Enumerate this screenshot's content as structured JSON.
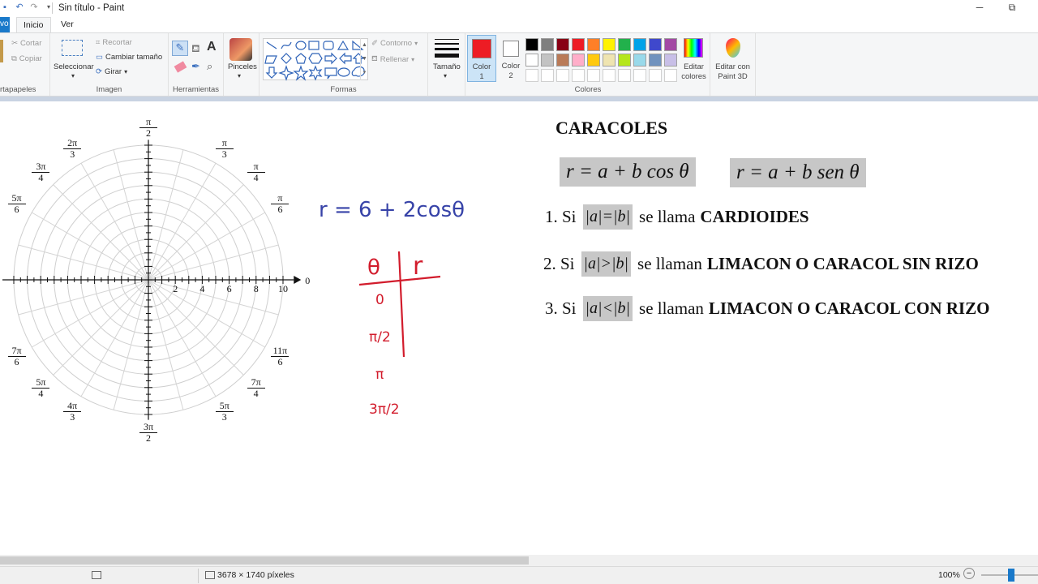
{
  "window": {
    "title": "Sin título - Paint",
    "minimize": "─",
    "restore": "⧉"
  },
  "tabs": {
    "file": "vo",
    "home": "Inicio",
    "view": "Ver"
  },
  "ribbon": {
    "clipboard": {
      "cut": "Cortar",
      "copy": "Copiar",
      "label": "rtapapeles"
    },
    "image": {
      "select": "Seleccionar",
      "crop": "Recortar",
      "resize": "Cambiar tamaño",
      "rotate": "Girar",
      "label": "Imagen"
    },
    "tools": {
      "label": "Herramientas",
      "text_glyph": "A"
    },
    "brushes": {
      "label": "Pinceles"
    },
    "shapes": {
      "outline": "Contorno",
      "fill": "Rellenar",
      "label": "Formas"
    },
    "size": {
      "label": "Tamaño"
    },
    "color1": {
      "label1": "Color",
      "label2": "1",
      "value": "#ed1c24"
    },
    "color2": {
      "label1": "Color",
      "label2": "2",
      "value": "#ffffff"
    },
    "colors": {
      "label": "Colores",
      "row1": [
        "#000000",
        "#7f7f7f",
        "#880015",
        "#ed1c24",
        "#ff7f27",
        "#fff200",
        "#22b14c",
        "#00a2e8",
        "#3f48cc",
        "#a349a4"
      ],
      "row2": [
        "#ffffff",
        "#c3c3c3",
        "#b97a57",
        "#ffaec9",
        "#ffc90e",
        "#efe4b0",
        "#b5e61d",
        "#99d9ea",
        "#7092be",
        "#c8bfe7"
      ]
    },
    "edit_colors": {
      "line1": "Editar",
      "line2": "colores"
    },
    "paint3d": {
      "line1": "Editar con",
      "line2": "Paint 3D"
    }
  },
  "canvas": {
    "heading": "CARACOLES",
    "formula_cos": "r = a + b cos θ",
    "formula_sen": "r = a + b sen θ",
    "items": [
      {
        "num": "1.",
        "si": "Si",
        "cond": "|a|=|b|",
        "verb": "se llama",
        "name": "CARDIOIDES"
      },
      {
        "num": "2.",
        "si": "Si",
        "cond": "|a|>|b|",
        "verb": "se llaman",
        "name": "LIMACON O CARACOL SIN RIZO"
      },
      {
        "num": "3.",
        "si": "Si",
        "cond": "|a|<|b|",
        "verb": "se llaman",
        "name": "LIMACON O CARACOL CON RIZO"
      }
    ],
    "handwritten": {
      "equation": "r = 6 + 2cosθ",
      "col_theta": "θ",
      "col_r": "r",
      "rows": [
        "0",
        "π/2",
        "π",
        "3π/2"
      ]
    },
    "polar": {
      "axis_zero": "0",
      "ticks": [
        "2",
        "4",
        "6",
        "8",
        "10"
      ],
      "angles": [
        {
          "n": "π",
          "d": "2"
        },
        {
          "n": "π",
          "d": "3"
        },
        {
          "n": "π",
          "d": "4"
        },
        {
          "n": "π",
          "d": "6"
        },
        {
          "n": "2π",
          "d": "3"
        },
        {
          "n": "3π",
          "d": "4"
        },
        {
          "n": "5π",
          "d": "6"
        },
        {
          "n": "7π",
          "d": "6"
        },
        {
          "n": "5π",
          "d": "4"
        },
        {
          "n": "4π",
          "d": "3"
        },
        {
          "n": "3π",
          "d": "2"
        },
        {
          "n": "5π",
          "d": "3"
        },
        {
          "n": "7π",
          "d": "4"
        },
        {
          "n": "11π",
          "d": "6"
        }
      ]
    }
  },
  "status": {
    "dimensions": "3678 × 1740 píxeles",
    "zoom": "100%",
    "zoom_out": "−",
    "zoom_level": 1.0
  }
}
